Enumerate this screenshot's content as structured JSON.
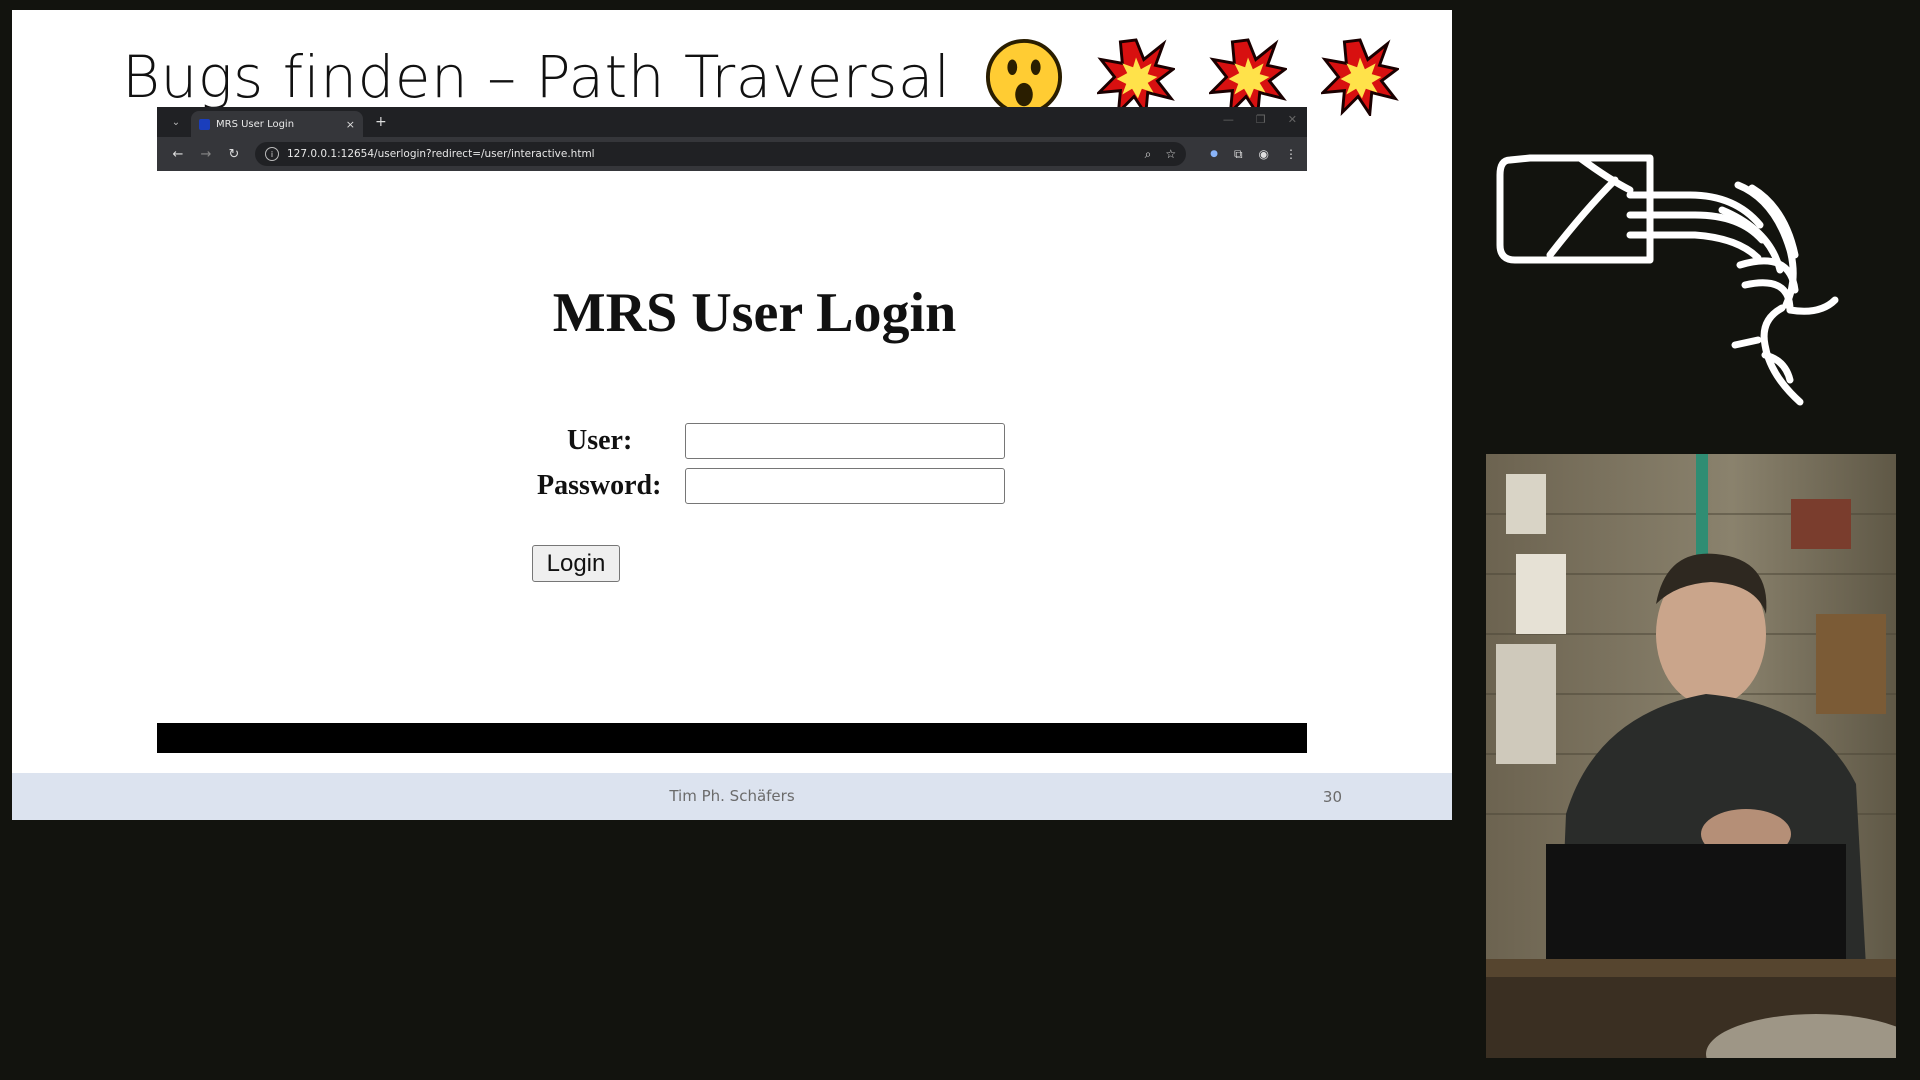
{
  "slide": {
    "title": "Bugs finden – Path Traversal",
    "emojis": [
      "face-open-mouth-icon",
      "collision-icon",
      "collision-icon",
      "collision-icon"
    ],
    "footer_author": "Tim Ph. Schäfers",
    "page_number": "30"
  },
  "browser": {
    "tab_title": "MRS User Login",
    "tab_close": "×",
    "new_tab": "+",
    "url": "127.0.0.1:12654/userlogin?redirect=/user/interactive.html"
  },
  "login": {
    "heading": "MRS User Login",
    "user_label": "User:",
    "user_value": "",
    "password_label": "Password:",
    "password_value": "",
    "button_label": "Login"
  },
  "colors": {
    "background": "#12130e",
    "footer_band": "#dce3ef",
    "browser_chrome": "#202124"
  }
}
